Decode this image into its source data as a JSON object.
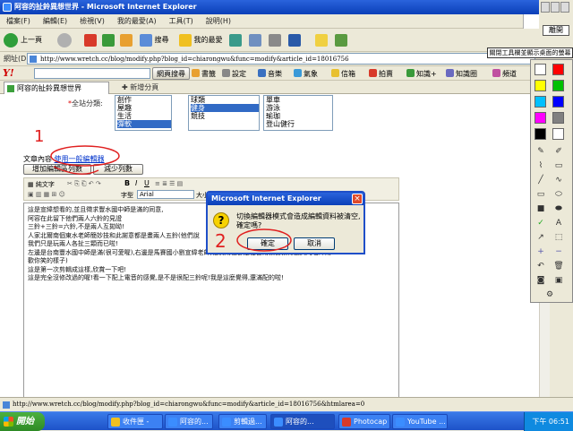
{
  "window": {
    "title": "阿容的扯鈴異想世界 - Microsoft Internet Explorer"
  },
  "menu": [
    "檔案(F)",
    "編輯(E)",
    "檢視(V)",
    "我的最愛(A)",
    "工具(T)",
    "說明(H)"
  ],
  "toolbar": {
    "back": "上一頁",
    "search": "搜尋",
    "favorites": "我的最愛"
  },
  "address": {
    "label": "網址(D)",
    "url": "http://www.wretch.cc/blog/modify.php?blog_id=chiarongwu&func=modify&article_id=18016756"
  },
  "yahoo": {
    "logo": "Y!",
    "search_btn": "網頁搜尋",
    "items": [
      "書籤",
      "設定",
      "音樂",
      "氣象",
      "信箱",
      "拍賣",
      "知識+",
      "知識圈",
      "頻道"
    ]
  },
  "tabs": {
    "active": "阿容的扯鈴異想世界",
    "new": "新增分頁"
  },
  "form": {
    "category_label": "全站分類:",
    "list1": [
      "創作",
      "屋趣",
      "生活",
      "彈軟"
    ],
    "list2": [
      "球類",
      "健身",
      "競技"
    ],
    "list3": [
      "單車",
      "游泳",
      "瑜珈",
      "登山健行"
    ],
    "content_label": "文章內容",
    "use_plain_editor": "使用一般編輯器",
    "add_rows": "增加編輯區列數",
    "reduce_rows": "減少列數"
  },
  "editor_toolbar": {
    "plain_text": "純文字",
    "font_label": "字型",
    "font_value": "Arial",
    "size_label": "大小"
  },
  "article_lines": [
    "這是宣緯想看的,並且徵求豐水國中師是滿的同意,",
    "阿容在此留下他們兩人六鈴的見證",
    "三鈴+三鈴=六鈴,不是兩人互拋呦!",
    "人家北爾南個東水老師簡妙技和此謝意都是畫兩人五鈴(他們說",
    "我們只是玩兩人各扯三顆而已啦!",
    "左邊是台南豐水國中師是滿(很可愛喔),右邊是馬賽國小劉宣緯老師,他們兩位都是在台南教書教得蠻久的老師兩",
    "歡你笑的樣子)",
    "",
    "這是第一次剪輯成這樣,欣賞一下吧!",
    "",
    "這是完全沒修改過的喔!看一下配上電音的感覺,是不是很配三鈴呢!我是這麼覺得,還滿配的啦!"
  ],
  "dialog": {
    "title": "Microsoft Internet Explorer",
    "message_line1": "切換編輯器模式會造成編輯資料被清空,",
    "message_line2": "確定嗎?",
    "ok": "確定",
    "cancel": "取消",
    "icon": "?"
  },
  "annotations": {
    "mark1": "1",
    "mark2": "2"
  },
  "status_url": "http://www.wretch.cc/blog/modify.php?blog_id=chiarongwu&func=modify&article_id=18016756&htmlarea=0",
  "taskbar": {
    "start": "開始",
    "tasks": [
      "收件匣 -",
      "阿容的...",
      "剪輯過...",
      "阿容的...",
      "Photocap",
      "YouTube ..."
    ],
    "clock": "下午 06:51"
  },
  "overlay": {
    "close": "離開",
    "tip": "關閉工具欄並顯示桌面的螢幕"
  },
  "pen_colors": [
    "#ff0000",
    "#ffff00",
    "#00c000",
    "#00c0ff",
    "#0000ff",
    "#000000",
    "#ff00ff",
    "#ffffff"
  ]
}
